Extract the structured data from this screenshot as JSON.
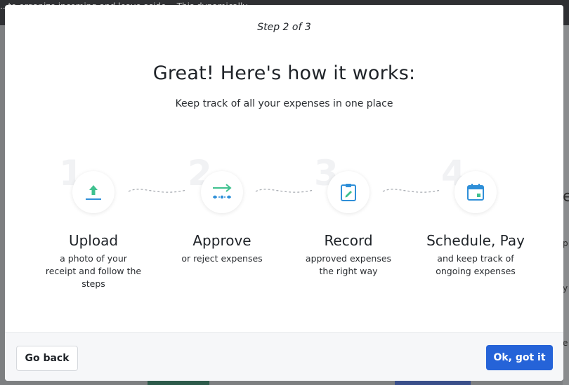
{
  "background": {
    "topbar_text": "...to organize incoming and leave aside... This dynamically",
    "right_fragments": [
      "e",
      "p",
      "y",
      "e"
    ]
  },
  "modal": {
    "step_label": "Step 2 of 3",
    "title": "Great! Here's how it works:",
    "subtitle": "Keep track of all your expenses in one place",
    "steps": [
      {
        "number": "1",
        "title": "Upload",
        "description": "a photo of your receipt and follow the steps",
        "icon": "upload-icon",
        "icon_color": "#3fc18f"
      },
      {
        "number": "2",
        "title": "Approve",
        "description": "or reject expenses",
        "icon": "approve-arrow-icon",
        "icon_color": "#2aa6a6"
      },
      {
        "number": "3",
        "title": "Record",
        "description": "approved expenses the right way",
        "icon": "clipboard-edit-icon",
        "icon_color": "#2f8fd8"
      },
      {
        "number": "4",
        "title": "Schedule, Pay",
        "description": "and keep track of ongoing expenses",
        "icon": "calendar-icon",
        "icon_color": "#2f8fd8"
      }
    ]
  },
  "footer": {
    "back_label": "Go back",
    "ok_label": "Ok, got it"
  },
  "colors": {
    "primary": "#2563d8",
    "overlay": "#7d7f81"
  }
}
